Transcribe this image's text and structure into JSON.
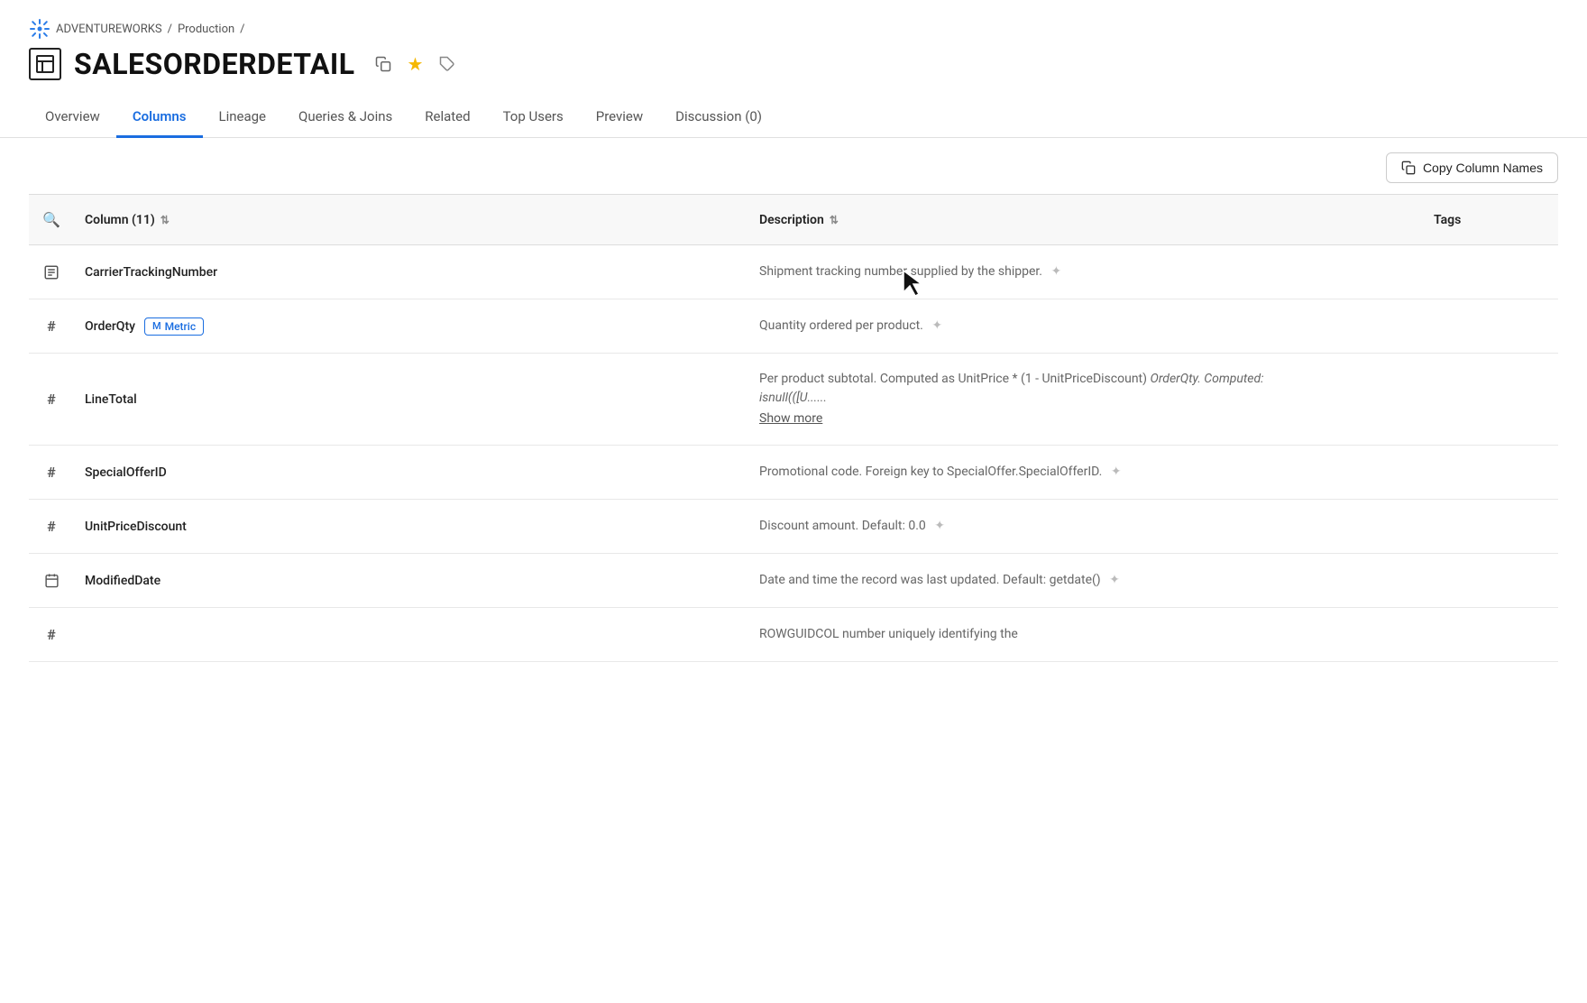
{
  "breadcrumb": {
    "items": [
      "ADVENTUREWORKS",
      "/",
      "Production",
      "/"
    ]
  },
  "page": {
    "title": "SALESORDERDETAIL",
    "icon": "table-icon"
  },
  "tabs": [
    {
      "id": "overview",
      "label": "Overview",
      "active": false
    },
    {
      "id": "columns",
      "label": "Columns",
      "active": true
    },
    {
      "id": "lineage",
      "label": "Lineage",
      "active": false
    },
    {
      "id": "queries-joins",
      "label": "Queries & Joins",
      "active": false
    },
    {
      "id": "related",
      "label": "Related",
      "active": false
    },
    {
      "id": "top-users",
      "label": "Top Users",
      "active": false
    },
    {
      "id": "preview",
      "label": "Preview",
      "active": false
    },
    {
      "id": "discussion",
      "label": "Discussion (0)",
      "active": false
    }
  ],
  "toolbar": {
    "copy_button_label": "Copy Column Names"
  },
  "table": {
    "column_header": "Column (11)",
    "description_header": "Description",
    "tags_header": "Tags",
    "rows": [
      {
        "type": "T",
        "name": "CarrierTrackingNumber",
        "description": "Shipment tracking number supplied by the shipper.",
        "has_add_tag": true,
        "badge": null,
        "show_more": false
      },
      {
        "type": "#",
        "name": "OrderQty",
        "description": "Quantity ordered per product.",
        "has_add_tag": true,
        "badge": "Metric",
        "show_more": false
      },
      {
        "type": "#",
        "name": "LineTotal",
        "description": "Per product subtotal. Computed as UnitPrice * (1 - UnitPriceDiscount) OrderQty. Computed: isnull(([U......",
        "description_italic_part": "OrderQty. Computed:",
        "has_add_tag": false,
        "badge": null,
        "show_more": true
      },
      {
        "type": "#",
        "name": "SpecialOfferID",
        "description": "Promotional code. Foreign key to SpecialOffer.SpecialOfferID.",
        "has_add_tag": true,
        "badge": null,
        "show_more": false
      },
      {
        "type": "#",
        "name": "UnitPriceDiscount",
        "description": "Discount amount. Default: 0.0",
        "has_add_tag": true,
        "badge": null,
        "show_more": false
      },
      {
        "type": "cal",
        "name": "ModifiedDate",
        "description": "Date and time the record was last updated. Default: getdate()",
        "has_add_tag": true,
        "badge": null,
        "show_more": false
      },
      {
        "type": "#",
        "name": "",
        "description": "ROWGUIDCOL number uniquely identifying the",
        "has_add_tag": false,
        "badge": null,
        "show_more": false,
        "partial": true
      }
    ]
  }
}
